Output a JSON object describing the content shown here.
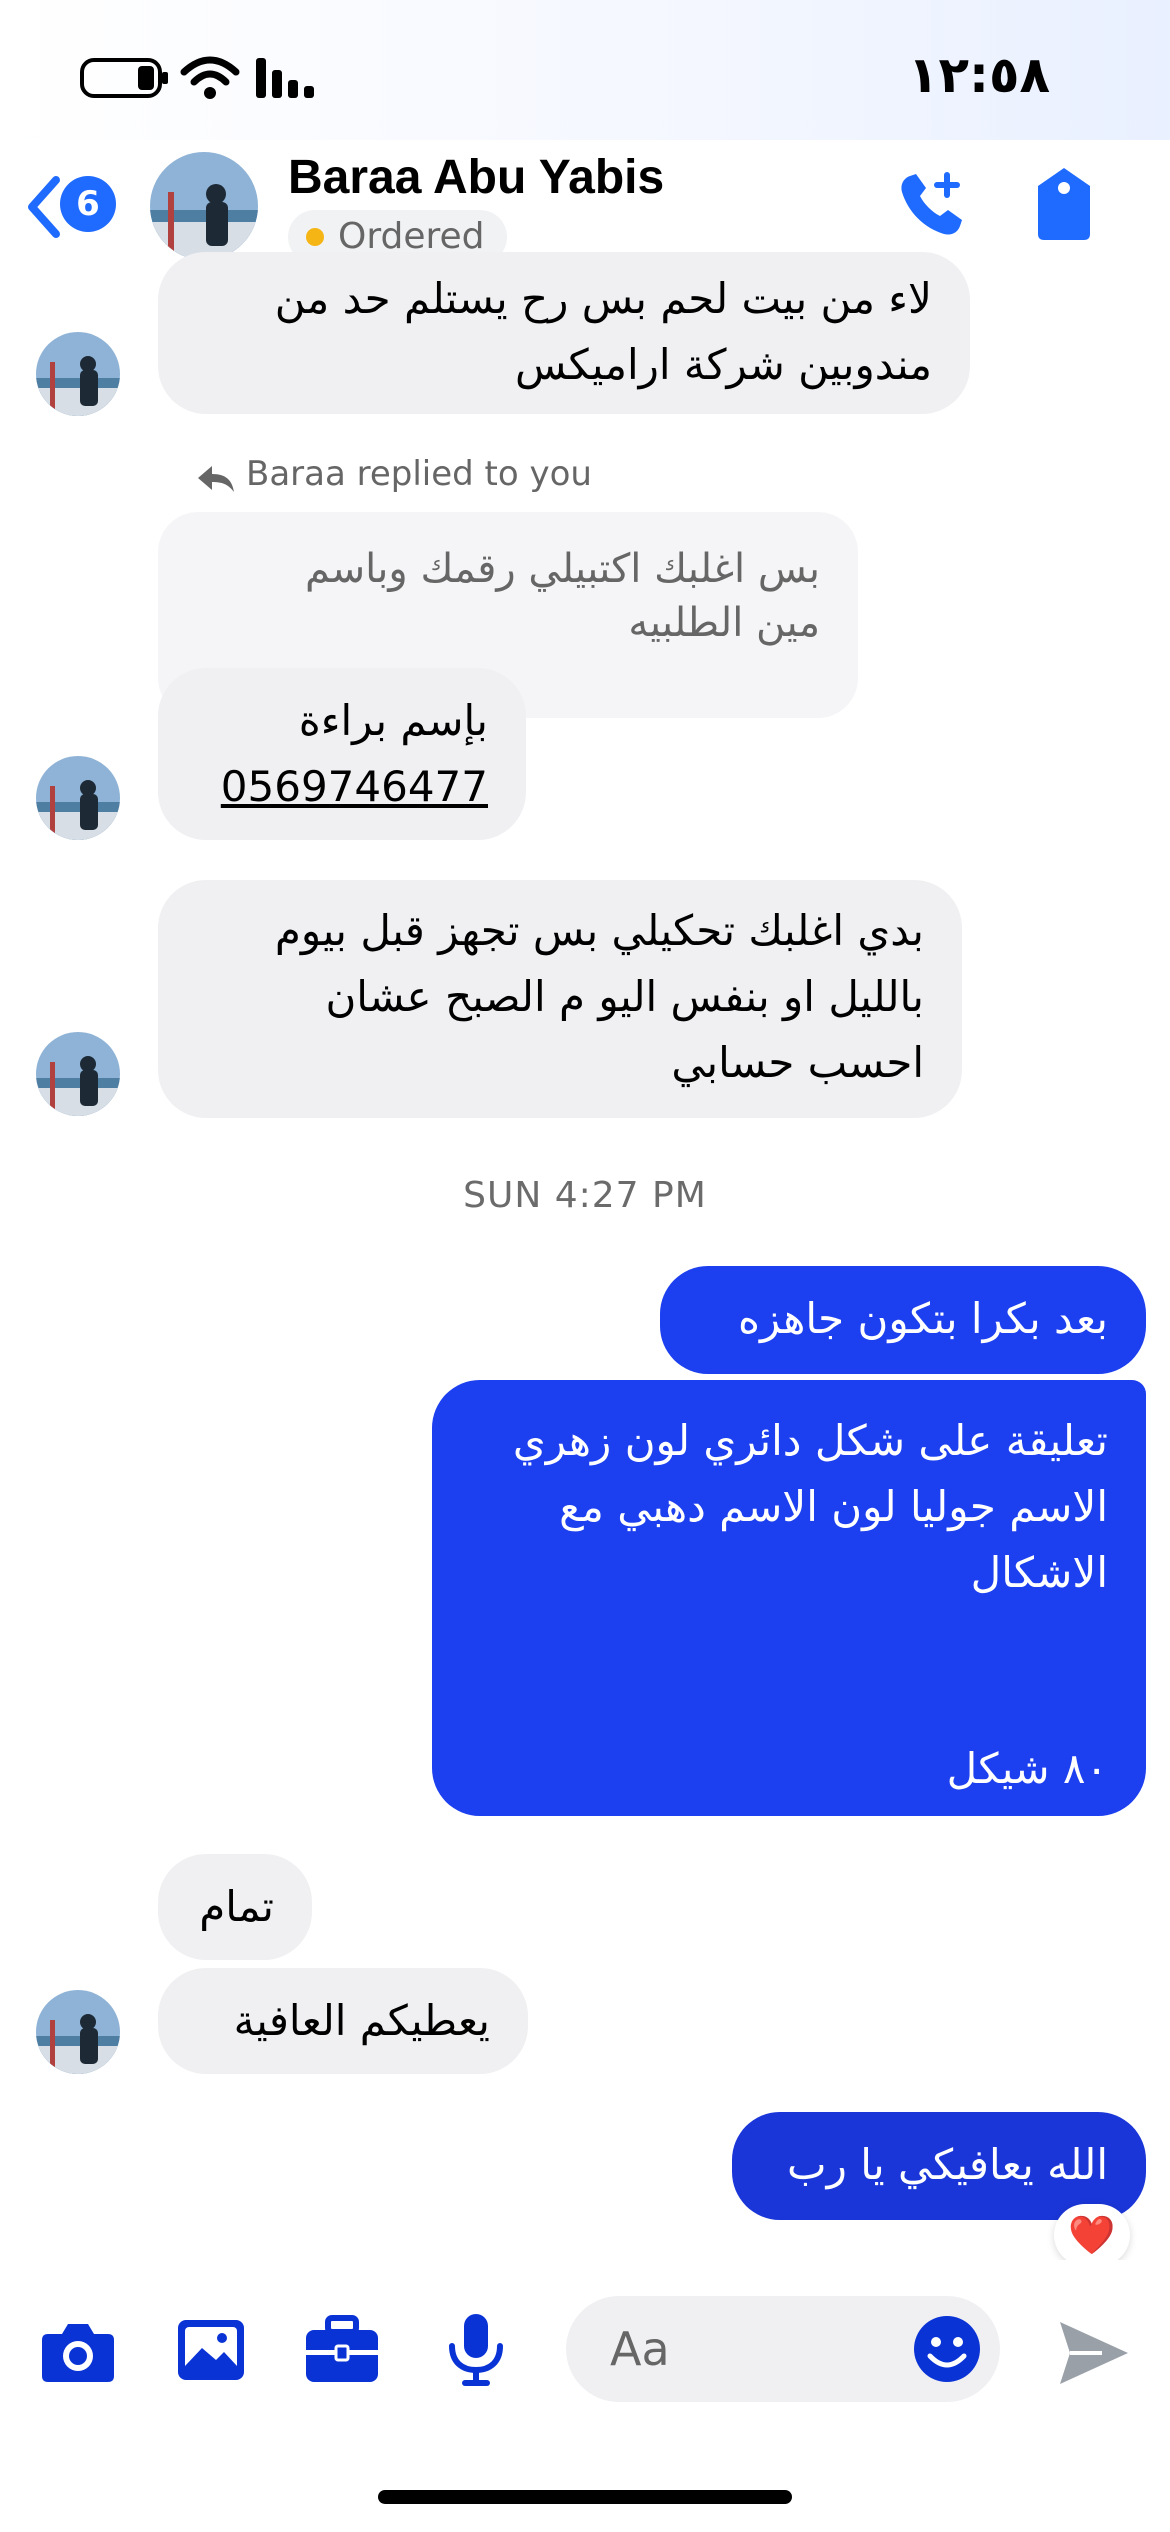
{
  "status_bar": {
    "time": "١٢:٥٨"
  },
  "header": {
    "back_badge_count": "6",
    "contact_name": "Baraa Abu Yabis",
    "status_label": "Ordered"
  },
  "messages": [
    {
      "dir": "in",
      "lines": [
        "لاء من بيت لحم بس رح يستلم حد من",
        "مندوبين شركة اراميكس"
      ]
    },
    {
      "reply_note": "Baraa replied to you"
    },
    {
      "quoted_lines": [
        "بس اغلبك اكتبيلي رقمك وباسم",
        "مين الطلبيه"
      ]
    },
    {
      "dir": "in",
      "lines": [
        "بإسم براءة"
      ],
      "phone": "0569746477"
    },
    {
      "dir": "in",
      "lines": [
        "بدي اغلبك تحكيلي بس تجهز قبل بيوم",
        "بالليل او بنفس اليو م الصبح عشان",
        "احسب حسابي"
      ]
    },
    {
      "timestamp": "SUN 4:27 PM"
    },
    {
      "dir": "out",
      "lines": [
        "بعد بكرا بتكون جاهزه"
      ]
    },
    {
      "dir": "out",
      "lines": [
        "تعليقة على شكل دائري لون زهري",
        "الاسم جوليا لون الاسم دهبي مع",
        "الاشكال",
        "٨٠ شيكل"
      ]
    },
    {
      "dir": "in",
      "lines": [
        "تمام"
      ]
    },
    {
      "dir": "in",
      "lines": [
        "يعطيكم العافية"
      ]
    },
    {
      "dir": "out",
      "lines": [
        "الله يعافيكي يا رب"
      ],
      "reaction": "❤️"
    }
  ],
  "composer": {
    "placeholder": "Aa"
  },
  "icons": [
    "back-chevron-icon",
    "phone-add-icon",
    "tag-icon",
    "camera-icon",
    "gallery-icon",
    "briefcase-icon",
    "microphone-icon",
    "emoji-icon",
    "send-icon",
    "reply-arrow-icon",
    "heart-reaction-icon"
  ],
  "colors": {
    "accent": "#1c3fef",
    "incoming_bubble": "#f0f0f3",
    "status_dot": "#f5b515"
  }
}
